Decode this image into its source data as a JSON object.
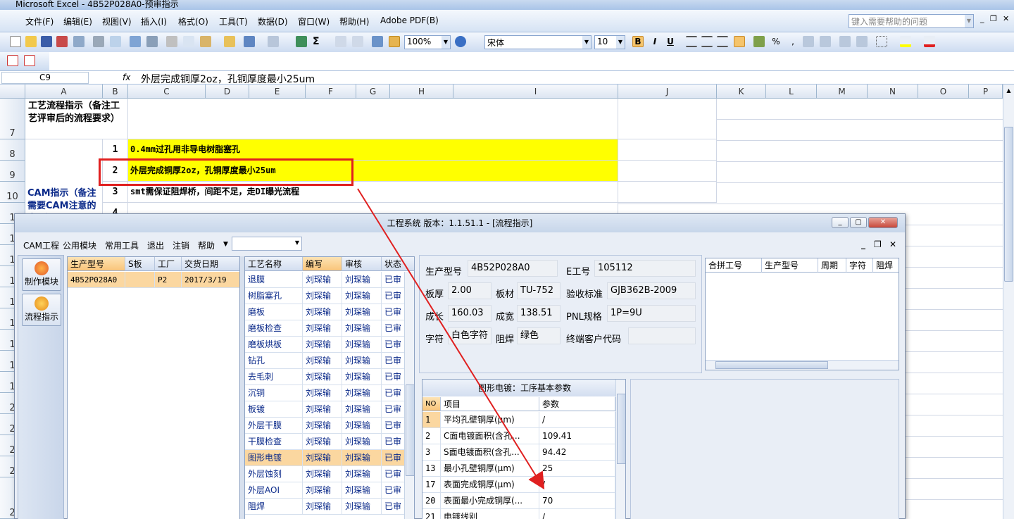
{
  "app": {
    "title": "Microsoft Excel - 4B52P028A0-预审指示"
  },
  "menu": {
    "items": [
      "文件(F)",
      "编辑(E)",
      "视图(V)",
      "插入(I)",
      "格式(O)",
      "工具(T)",
      "数据(D)",
      "窗口(W)",
      "帮助(H)",
      "Adobe PDF(B)"
    ],
    "help_placeholder": "键入需要帮助的问题"
  },
  "toolbar": {
    "zoom": "100%",
    "font": "宋体",
    "font_size": "10",
    "bold": "B",
    "italic": "I",
    "underline": "U",
    "percent": "%",
    "comma": ","
  },
  "formula_bar": {
    "cell_ref": "C9",
    "fx": "fx",
    "content": "外层完成铜厚2oz，孔铜厚度最小25um"
  },
  "columns": [
    "A",
    "B",
    "C",
    "D",
    "E",
    "F",
    "G",
    "H",
    "I",
    "J",
    "K",
    "L",
    "M",
    "N",
    "O",
    "P"
  ],
  "rows": [
    "7",
    "8",
    "9",
    "10",
    "1",
    "1",
    "1",
    "1",
    "1",
    "1",
    "1",
    "1",
    "1",
    "2",
    "2",
    "2",
    "2",
    "2"
  ],
  "sheet": {
    "a7": "工艺流程指示（备注工艺评审后的流程要求）",
    "a10": "CAM指示（备注需要CAM注意的事项）",
    "b8": "1",
    "b9": "2",
    "b10": "3",
    "b11": "4",
    "c8": "0.4mm过孔用非导电树脂塞孔",
    "c9": "外层完成铜厚2oz，孔铜厚度最小25um",
    "c10": "smt需保证阻焊桥，间距不足，走DI曝光流程"
  },
  "window": {
    "title": "工程系统   版本：1.1.51.1 - [流程指示]",
    "menu": [
      "CAM工程",
      "公用模块",
      "常用工具",
      "退出",
      "注销",
      "帮助"
    ],
    "side_buttons": [
      "制作模块",
      "流程指示"
    ]
  },
  "orders": {
    "headers": [
      "生产型号",
      "S板",
      "工厂",
      "交货日期"
    ],
    "rows": [
      [
        "4B52P028A0",
        "",
        "P2",
        "2017/3/19"
      ]
    ]
  },
  "processes": {
    "headers": [
      "工艺名称",
      "编写",
      "审核",
      "状态"
    ],
    "rows": [
      [
        "退膜",
        "刘琛输",
        "刘琛输",
        "已审"
      ],
      [
        "树脂塞孔",
        "刘琛输",
        "刘琛输",
        "已审"
      ],
      [
        "磨板",
        "刘琛输",
        "刘琛输",
        "已审"
      ],
      [
        "磨板检查",
        "刘琛输",
        "刘琛输",
        "已审"
      ],
      [
        "磨板烘板",
        "刘琛输",
        "刘琛输",
        "已审"
      ],
      [
        "钻孔",
        "刘琛输",
        "刘琛输",
        "已审"
      ],
      [
        "去毛刺",
        "刘琛输",
        "刘琛输",
        "已审"
      ],
      [
        "沉铜",
        "刘琛输",
        "刘琛输",
        "已审"
      ],
      [
        "板镀",
        "刘琛输",
        "刘琛输",
        "已审"
      ],
      [
        "外层干膜",
        "刘琛输",
        "刘琛输",
        "已审"
      ],
      [
        "干膜检查",
        "刘琛输",
        "刘琛输",
        "已审"
      ],
      [
        "图形电镀",
        "刘琛输",
        "刘琛输",
        "已审"
      ],
      [
        "外层蚀刻",
        "刘琛输",
        "刘琛输",
        "已审"
      ],
      [
        "外层AOI",
        "刘琛输",
        "刘琛输",
        "已审"
      ],
      [
        "阻焊",
        "刘琛输",
        "刘琛输",
        "已审"
      ]
    ],
    "selected_index": 11
  },
  "info": {
    "model_label": "生产型号",
    "model": "4B52P028A0",
    "e_label": "E工号",
    "e_no": "105112",
    "thick_label": "板厚",
    "thick": "2.00",
    "mat_label": "板材",
    "mat": "TU-752",
    "std_label": "验收标准",
    "std": "GJB362B-2009",
    "len_label": "成长",
    "len": "160.03",
    "wid_label": "成宽",
    "wid": "138.51",
    "pnl_label": "PNL规格",
    "pnl": "1P=9U",
    "char_label": "字符",
    "char": "白色字符",
    "mask_label": "阻焊",
    "mask": "绿色",
    "cust_label": "终端客户代码",
    "cust": ""
  },
  "combine": {
    "headers": [
      "合拼工号",
      "生产型号",
      "周期",
      "字符",
      "阻焊"
    ]
  },
  "params": {
    "title": "图形电镀：工序基本参数",
    "headers": [
      "NO",
      "项目",
      "参数"
    ],
    "rows": [
      [
        "1",
        "平均孔壁铜厚(μm)",
        "/"
      ],
      [
        "2",
        "C面电镀面积(含孔...",
        "109.41"
      ],
      [
        "3",
        "S面电镀面积(含孔...",
        "94.42"
      ],
      [
        "13",
        "最小孔壁铜厚(μm)",
        "25"
      ],
      [
        "17",
        "表面完成铜厚(μm)",
        "/"
      ],
      [
        "20",
        "表面最小完成铜厚(...",
        "70"
      ],
      [
        "21",
        "电镀线别",
        "/"
      ]
    ]
  },
  "colors": {
    "highlight_yellow": "#ffff00",
    "annotation_red": "#e02020",
    "selected_row": "#fbd7a0"
  }
}
